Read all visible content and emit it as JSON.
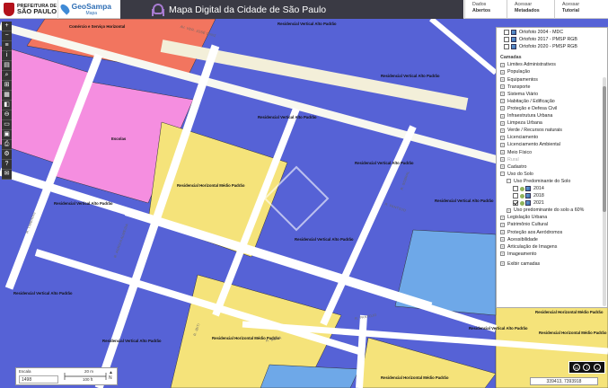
{
  "header": {
    "prefeitura_top": "PREFEITURA DE",
    "prefeitura_bottom": "SÃO PAULO",
    "geosampa": "GeoSampa",
    "geosampa_sub": "Mapa",
    "title": "Mapa Digital da Cidade de São Paulo",
    "nav": [
      {
        "line1": "Dados",
        "line2": "Abertos"
      },
      {
        "line1": "Acessar",
        "line2": "Metadados"
      },
      {
        "line1": "Acessar",
        "line2": "Tutorial"
      }
    ]
  },
  "toolbar": [
    "+",
    "−",
    "≡",
    "i",
    "▤",
    "⌕",
    "⊞",
    "▦",
    "◧",
    "⊖",
    "▭",
    "▣",
    "⎙",
    "⚙",
    "?",
    "✉"
  ],
  "panel": {
    "orto": [
      {
        "label": "Ortofoto 2004 - MDC",
        "checked": false
      },
      {
        "label": "Ortofoto 2017 - PMSP RGB",
        "checked": false
      },
      {
        "label": "Ortofoto 2020 - PMSP RGB",
        "checked": false
      }
    ],
    "camadas_title": "Camadas",
    "items": [
      "Limites Administrativos",
      "População",
      "Equipamentos",
      "Transporte",
      "Sistema Viário",
      "Habitação / Edificação",
      "Proteção e Defesa Civil",
      "Infraestrutura Urbana",
      "Limpeza Urbana",
      "Verde / Recursos naturais",
      "Licenciamento",
      "Licenciamento Ambiental",
      "Meio Físico",
      "Rural",
      "Cadastro"
    ],
    "uso_solo": "Uso do Solo",
    "uso_predominante": "Uso Predominante do Solo",
    "years": [
      {
        "label": "2014",
        "checked": false
      },
      {
        "label": "2018",
        "checked": false
      },
      {
        "label": "2021",
        "checked": true
      }
    ],
    "uso_60": "Uso predominante do solo a 60%",
    "items2": [
      "Legislação Urbana",
      "Patrimônio Cultural",
      "Proteção aos Aeródromos",
      "Acessibilidade",
      "Articulação de Imagens",
      "Imageamento"
    ],
    "exibir": "Exibir camadas"
  },
  "map": {
    "labels": [
      "Comércio e Serviço Horizontal",
      "Residencial Vertical Alto Padrão",
      "Residencial Vertical Alto Padrão",
      "Residencial Vertical Alto Padrão",
      "Escolas",
      "Residencial Horizontal Médio Padrão",
      "Residencial Vertical Alto Padrão",
      "Residencial Vertical Alto Padrão",
      "Residencial Vertical Alto Padrão",
      "Residencial Vertical Alto Padrão",
      "Residencial Vertical Alto Padrão",
      "Residencial Horizontal Médio Padrão",
      "Residencial Horizontal Médio Padrão",
      "Residencial Horizontal Médio Padrão",
      "Residencial Vertical Alto Padrão",
      "Residencial Horizontal Médio Padrão",
      "Residencial Vertical Alto Padrão"
    ],
    "streets": [
      "AV. VER. JOSÉ DINIZ",
      "R. PANTOJO",
      "R. PANTOJO",
      "R. BUTIÁ",
      "R. IBITI",
      "R. SOBRAL",
      "R. TIMBIRAS",
      "R. AGRUIA ALMEIDA"
    ]
  },
  "scale": {
    "label": "Escala",
    "value": "1498",
    "top": "20 m",
    "bottom": "100 ft",
    "north": "N"
  },
  "coords": "339413, 7393918",
  "colors": {
    "blue": "#5662d6",
    "yellow": "#f5e37a",
    "pink": "#f58ee0",
    "orange": "#f2755f",
    "road": "#ffffff",
    "light_blue": "#6ea8e8"
  }
}
